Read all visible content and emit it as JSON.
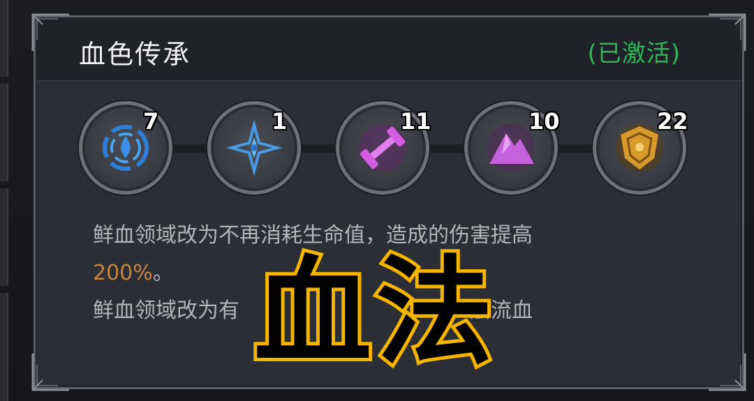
{
  "panel": {
    "title": "血色传承",
    "status": "(已激活)"
  },
  "runes": [
    {
      "icon": "blue-vortex-icon",
      "count": "7",
      "color": "#3a8ee8"
    },
    {
      "icon": "blue-star-icon",
      "count": "1",
      "color": "#4a9be6"
    },
    {
      "icon": "purple-dumbbell-icon",
      "count": "11",
      "color": "#d35de0"
    },
    {
      "icon": "purple-mountain-icon",
      "count": "10",
      "color": "#c561dc"
    },
    {
      "icon": "gold-shield-icon",
      "count": "22",
      "color": "#d69b2c"
    }
  ],
  "description": {
    "line1": "鲜血领域改为不再消耗生命值，造成的伤害提高",
    "line2_value": "200%",
    "line2_suffix": "。",
    "line3_start": "鲜血领域改为有",
    "line3_end": "层流血"
  },
  "overlay": {
    "text": "血法"
  },
  "colors": {
    "status_green": "#2fb65a",
    "highlight_orange": "#c9843b",
    "overlay_yellow": "#f4b400"
  }
}
